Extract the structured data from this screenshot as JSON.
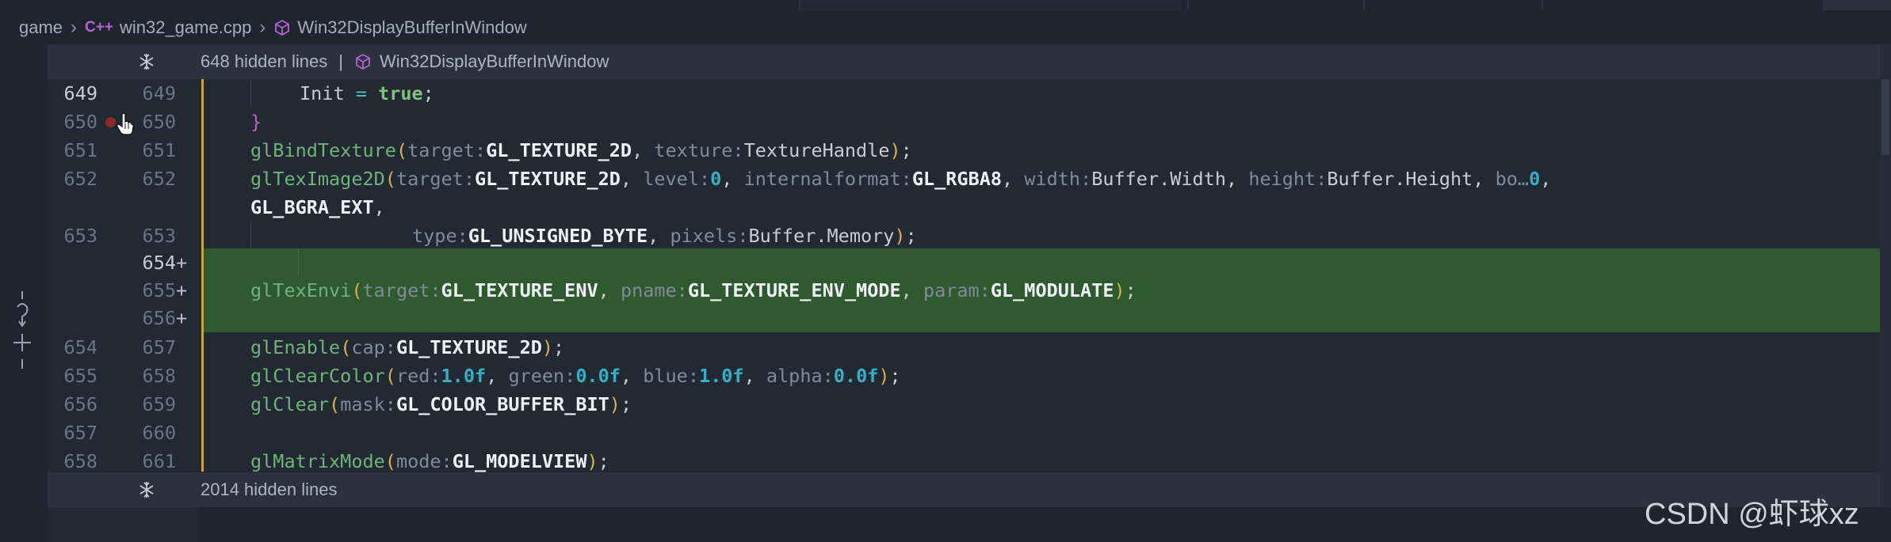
{
  "breadcrumb": {
    "folder": "game",
    "file_icon": "C++",
    "file": "win32_game.cpp",
    "symbol": "Win32DisplayBufferInWindow"
  },
  "hidden_top": {
    "text": "648 hidden lines",
    "separator": "|",
    "symbol": "Win32DisplayBufferInWindow"
  },
  "hidden_bottom": {
    "text": "2014 hidden lines"
  },
  "lines": [
    {
      "old": "649",
      "new": "649",
      "current": true
    },
    {
      "old": "650",
      "new": "650",
      "breakpoint": true
    },
    {
      "old": "651",
      "new": "651"
    },
    {
      "old": "652",
      "new": "652"
    },
    {
      "old": "",
      "new": ""
    },
    {
      "old": "653",
      "new": "653"
    },
    {
      "old": "",
      "new": "654",
      "added": true
    },
    {
      "old": "",
      "new": "655",
      "added": true
    },
    {
      "old": "",
      "new": "656",
      "added": true
    },
    {
      "old": "654",
      "new": "657"
    },
    {
      "old": "655",
      "new": "658"
    },
    {
      "old": "656",
      "new": "659"
    },
    {
      "old": "657",
      "new": "660"
    },
    {
      "old": "658",
      "new": "661"
    }
  ],
  "plus_sign": "+",
  "code": {
    "l649": {
      "text": "Init",
      "eq": "=",
      "kw": "true",
      "semi": ";"
    },
    "l650": {
      "brace": "}"
    },
    "l651": {
      "fn": "glBindTexture",
      "open": "(",
      "h1": "target:",
      "v1": "GL_TEXTURE_2D",
      "c1": ",",
      "h2": "texture:",
      "v2": "TextureHandle",
      "close": ")",
      "semi": ";"
    },
    "l652": {
      "fn": "glTexImage2D",
      "open": "(",
      "h1": "target:",
      "v1": "GL_TEXTURE_2D",
      "c1": ",",
      "h2": "level:",
      "v2": "0",
      "c2": ",",
      "h3": "internalformat:",
      "v3": "GL_RGBA8",
      "c3": ",",
      "h4": "width:",
      "v4": "Buffer.Width",
      "c4": ",",
      "h5": "height:",
      "v5": "Buffer.Height",
      "c5": ",",
      "h6": "bo…",
      "v6": "0",
      "c6": ","
    },
    "l652b": {
      "v": "GL_BGRA_EXT",
      "c": ","
    },
    "l653": {
      "h1": "type:",
      "v1": "GL_UNSIGNED_BYTE",
      "c1": ",",
      "h2": "pixels:",
      "v2": "Buffer.Memory",
      "close": ")",
      "semi": ";"
    },
    "l655": {
      "fn": "glTexEnvi",
      "open": "(",
      "h1": "target:",
      "v1": "GL_TEXTURE_ENV",
      "c1": ",",
      "h2": "pname:",
      "v2": "GL_TEXTURE_ENV_MODE",
      "c2": ",",
      "h3": "param:",
      "v3": "GL_MODULATE",
      "close": ")",
      "semi": ";"
    },
    "l657": {
      "fn": "glEnable",
      "open": "(",
      "h1": "cap:",
      "v1": "GL_TEXTURE_2D",
      "close": ")",
      "semi": ";"
    },
    "l658": {
      "fn": "glClearColor",
      "open": "(",
      "h1": "red:",
      "v1": "1.0f",
      "c1": ",",
      "h2": "green:",
      "v2": "0.0f",
      "c2": ",",
      "h3": "blue:",
      "v3": "1.0f",
      "c3": ",",
      "h4": "alpha:",
      "v4": "0.0f",
      "close": ")",
      "semi": ";"
    },
    "l659": {
      "fn": "glClear",
      "open": "(",
      "h1": "mask:",
      "v1": "GL_COLOR_BUFFER_BIT",
      "close": ")",
      "semi": ";"
    },
    "l661": {
      "fn": "glMatrixMode",
      "open": "(",
      "h1": "mode:",
      "v1": "GL_MODELVIEW",
      "close": ")",
      "semi": ";"
    }
  },
  "watermark": "CSDN @虾球xz",
  "colors": {
    "editor_bg": "#222933",
    "added_bg": "#2f5a2f",
    "modified_bar": "#c4a83a",
    "function": "#6fb37b",
    "number": "#34b0c4",
    "hint": "#7f8a9b"
  }
}
